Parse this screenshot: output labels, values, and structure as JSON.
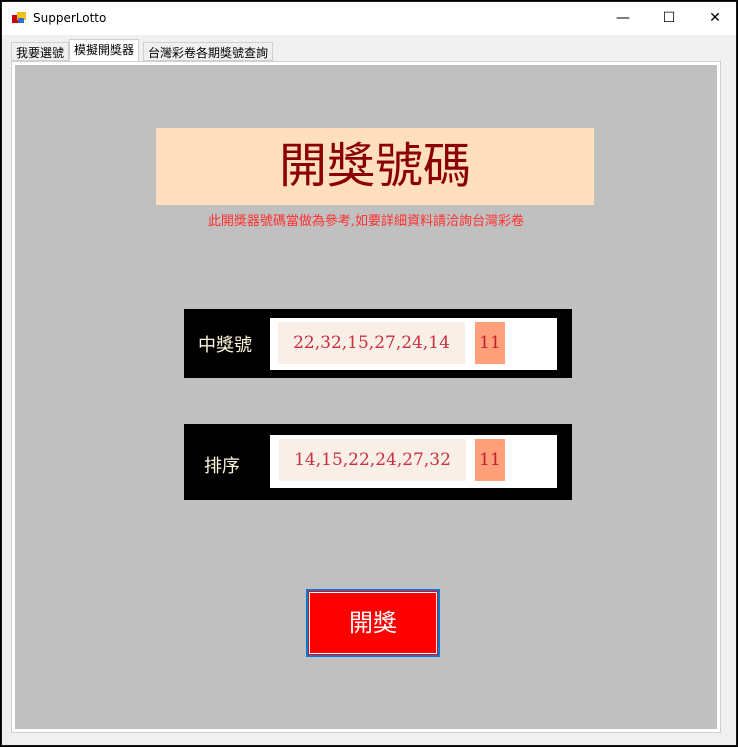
{
  "window": {
    "title": "SupperLotto",
    "minimize": "—",
    "maximize": "☐",
    "close": "✕"
  },
  "tabs": [
    {
      "label": "我要選號"
    },
    {
      "label": "模擬開獎器"
    },
    {
      "label": "台灣彩卷各期獎號查詢"
    }
  ],
  "active_tab": "模擬開獎器",
  "main": {
    "heading": "開獎號碼",
    "note": "此開獎器號碼當做為參考,如要詳細資料請洽詢台灣彩卷",
    "drawn": {
      "label": "中獎號",
      "numbers": "22,32,15,27,24,14",
      "special": "11"
    },
    "sorted": {
      "label": "排序",
      "numbers": "14,15,22,24,27,32",
      "special": "11"
    },
    "draw_button": "開獎"
  },
  "colors": {
    "panel": "#c0c0c0",
    "banner": "#ffdfc0",
    "button": "#ff0000",
    "special": "#ffa07a"
  }
}
